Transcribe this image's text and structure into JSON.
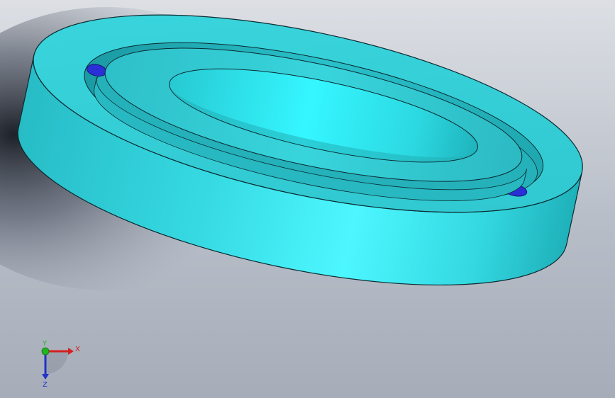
{
  "viewport": {
    "background_top": "#dcdfe4",
    "background_bottom": "#a6adb9",
    "model": {
      "name": "bearing",
      "part_color": "#39e3ea",
      "ball_color": "#2b2fd6",
      "edge_color": "#0b2a30"
    }
  },
  "triad": {
    "x_label": "X",
    "y_label": "Y",
    "z_label": "Z",
    "x_color": "#d42020",
    "y_color": "#22b522",
    "z_color": "#2233c8"
  }
}
